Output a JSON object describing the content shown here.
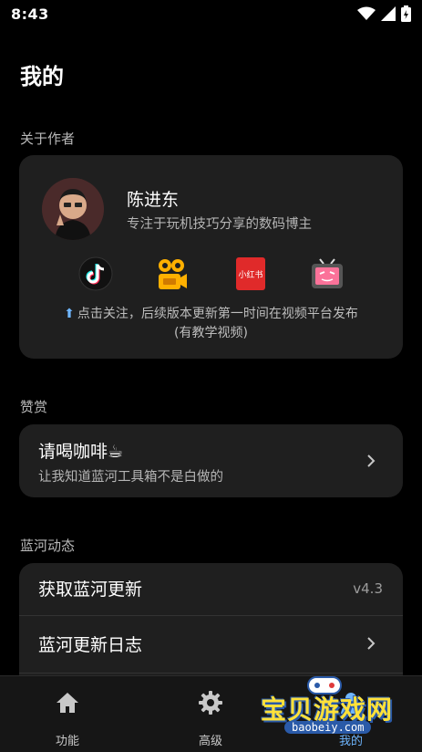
{
  "status_bar": {
    "time": "8:43",
    "icons": [
      "wifi-icon",
      "signal-icon",
      "battery-icon"
    ]
  },
  "page": {
    "title": "我的"
  },
  "sections": {
    "author": "关于作者",
    "donate": "赞赏",
    "updates": "蓝河动态"
  },
  "author": {
    "name": "陈进东",
    "description": "专注于玩机技巧分享的数码博主",
    "platforms": [
      "douyin-icon",
      "kuaishou-icon",
      "xiaohongshu-icon",
      "bilibili-icon"
    ],
    "xiaohongshu_text": "小红书",
    "follow_text": "点击关注，后续版本更新第一时间在视频平台发布",
    "follow_sub": "(有教学视频)"
  },
  "donate": {
    "title": "请喝咖啡☕",
    "subtitle": "让我知道蓝河工具箱不是白做的"
  },
  "updates": {
    "get_update_label": "获取蓝河更新",
    "version": "v4.3",
    "changelog_label": "蓝河更新日志"
  },
  "bottom_nav": [
    {
      "label": "功能",
      "icon": "home-icon"
    },
    {
      "label": "高级",
      "icon": "gear-icon"
    },
    {
      "label": "我的",
      "icon": "person-icon"
    }
  ],
  "watermark": {
    "text": "宝贝游戏网",
    "url": "baobeiy.com"
  },
  "colors": {
    "background": "#000000",
    "card": "#1f1f1f",
    "accent": "#6fb6ff"
  }
}
